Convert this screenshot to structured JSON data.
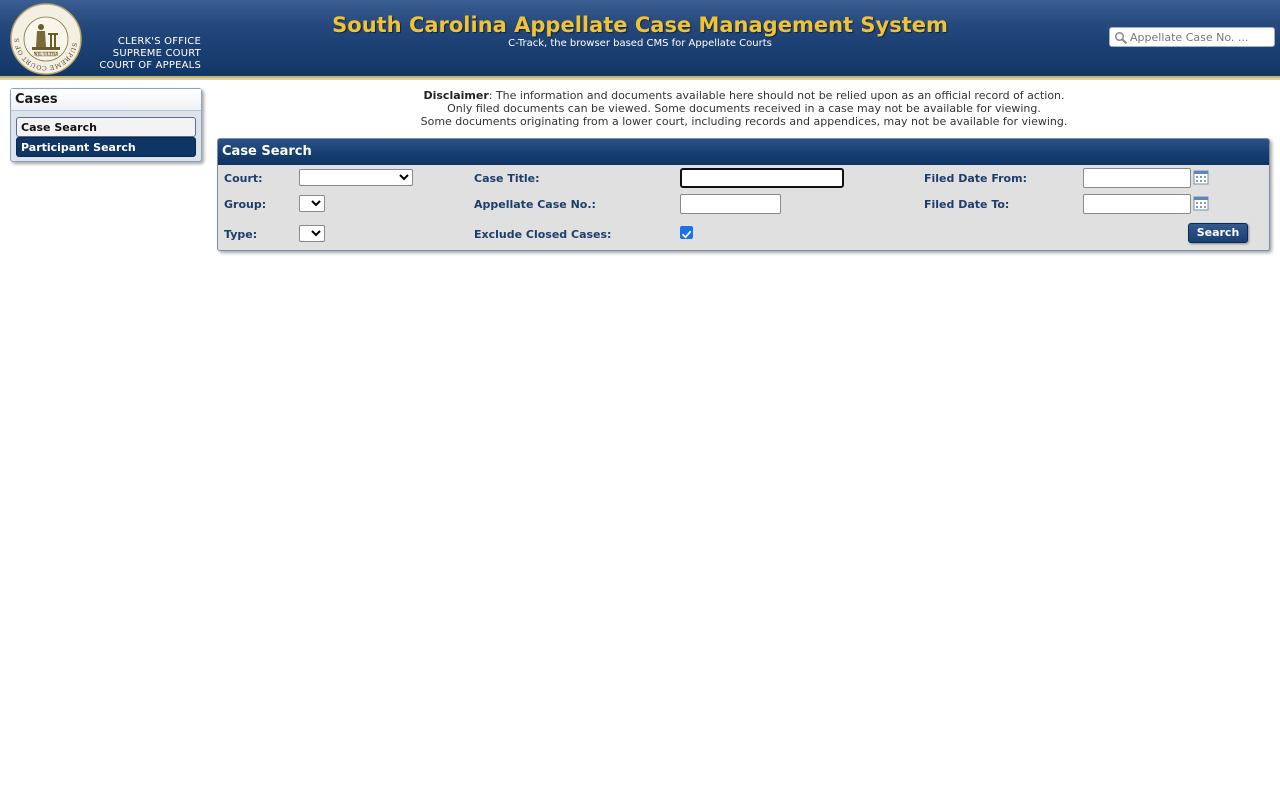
{
  "header": {
    "org_lines": [
      "CLERK'S OFFICE",
      "SUPREME COURT",
      "COURT OF APPEALS"
    ],
    "title": "South Carolina Appellate Case Management System",
    "subtitle": "C-Track, the browser based CMS for Appellate Courts",
    "seal_icon": "court-seal-icon",
    "seal_motto": "NIL ULTRA",
    "seal_text": "SUPREME COURT OF SOUTH CAROLINA",
    "quick_search": {
      "placeholder": "Appellate Case No. ...",
      "value": "",
      "icon": "search-icon"
    },
    "colors": {
      "title": "#f1c232",
      "header_bg": "#1a3f72"
    }
  },
  "sidebar": {
    "heading": "Cases",
    "items": [
      {
        "label": "Case Search",
        "active": true
      },
      {
        "label": "Participant Search",
        "active": false
      }
    ]
  },
  "disclaimer": {
    "label": "Disclaimer",
    "line1": ": The information and documents available here should not be relied upon as an official record of action.",
    "line2": "Only filed documents can be viewed. Some documents received in a case may not be available for viewing.",
    "line3": "Some documents originating from a lower court, including records and appendices, may not be available for viewing."
  },
  "case_search": {
    "title": "Case Search",
    "court_label": "Court:",
    "court_value": "",
    "group_label": "Group:",
    "group_value": "",
    "type_label": "Type:",
    "type_value": "",
    "case_title_label": "Case Title:",
    "case_title_value": "",
    "appellate_case_no_label": "Appellate Case No.:",
    "appellate_case_no_value": "",
    "exclude_closed_label": "Exclude Closed Cases:",
    "exclude_closed_checked": true,
    "filed_date_from_label": "Filed Date From:",
    "filed_date_from_value": "",
    "filed_date_to_label": "Filed Date To:",
    "filed_date_to_value": "",
    "calendar_icon": "calendar-icon",
    "search_button": "Search"
  }
}
